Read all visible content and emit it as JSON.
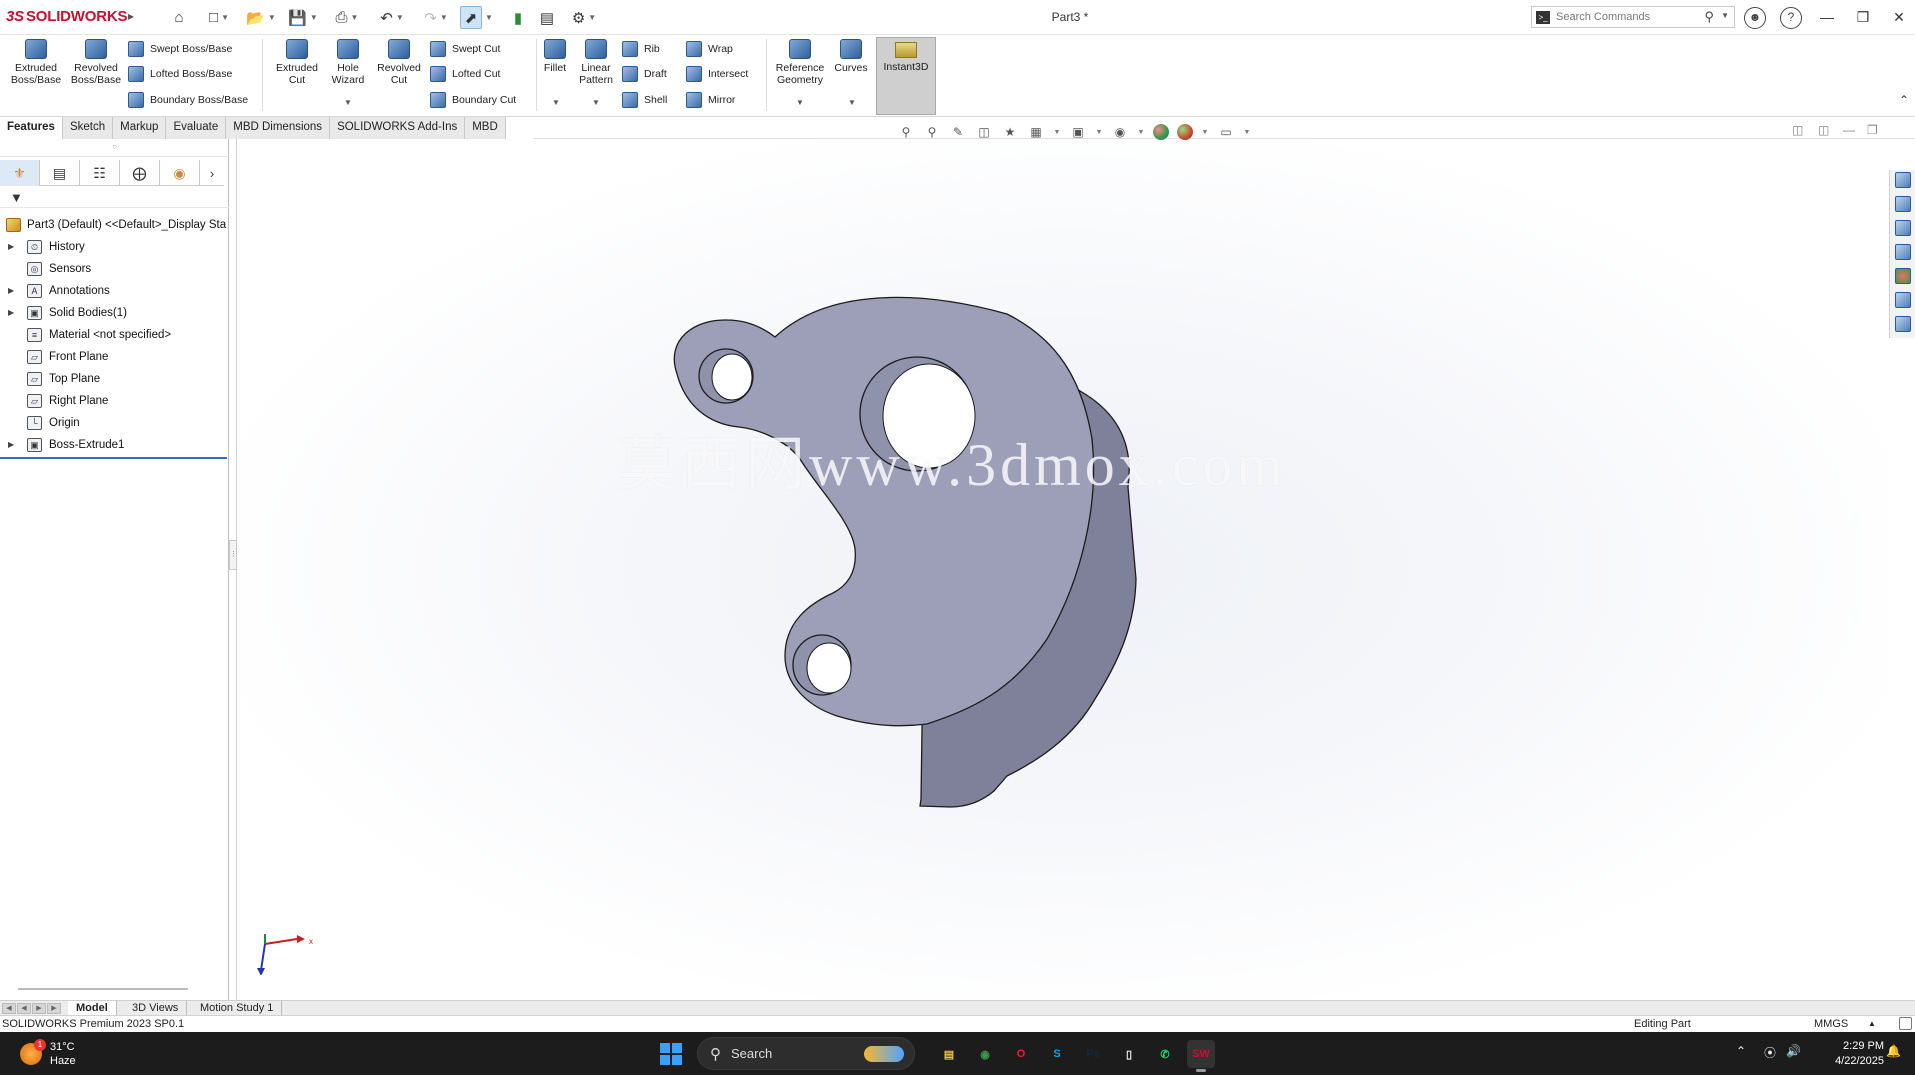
{
  "app": {
    "brand_prefix": "3S",
    "brand": "SOLIDWORKS",
    "document_title": "Part3 *"
  },
  "search": {
    "placeholder": "Search Commands"
  },
  "ribbon": {
    "extruded_boss": "Extruded Boss/Base",
    "revolved_boss": "Revolved Boss/Base",
    "swept_boss": "Swept Boss/Base",
    "lofted_boss": "Lofted Boss/Base",
    "boundary_boss": "Boundary Boss/Base",
    "extruded_cut": "Extruded Cut",
    "hole_wizard": "Hole Wizard",
    "revolved_cut": "Revolved Cut",
    "swept_cut": "Swept Cut",
    "lofted_cut": "Lofted Cut",
    "boundary_cut": "Boundary Cut",
    "fillet": "Fillet",
    "linear_pattern": "Linear Pattern",
    "rib": "Rib",
    "draft": "Draft",
    "shell": "Shell",
    "wrap": "Wrap",
    "intersect": "Intersect",
    "mirror": "Mirror",
    "reference_geometry": "Reference Geometry",
    "curves": "Curves",
    "instant3d": "Instant3D"
  },
  "command_tabs": [
    "Features",
    "Sketch",
    "Markup",
    "Evaluate",
    "MBD Dimensions",
    "SOLIDWORKS Add-Ins",
    "MBD"
  ],
  "feature_tree": {
    "root": "Part3 (Default) <<Default>_Display Sta",
    "items": [
      {
        "label": "History",
        "expandable": true,
        "icon": "history-icon",
        "glyph": "⏲"
      },
      {
        "label": "Sensors",
        "expandable": false,
        "icon": "sensor-icon",
        "glyph": "◎"
      },
      {
        "label": "Annotations",
        "expandable": true,
        "icon": "annotations-icon",
        "glyph": "A"
      },
      {
        "label": "Solid Bodies(1)",
        "expandable": true,
        "icon": "solid-bodies-icon",
        "glyph": "▣"
      },
      {
        "label": "Material <not specified>",
        "expandable": false,
        "icon": "material-icon",
        "glyph": "≡"
      },
      {
        "label": "Front Plane",
        "expandable": false,
        "icon": "plane-icon",
        "glyph": "▱"
      },
      {
        "label": "Top Plane",
        "expandable": false,
        "icon": "plane-icon",
        "glyph": "▱"
      },
      {
        "label": "Right Plane",
        "expandable": false,
        "icon": "plane-icon",
        "glyph": "▱"
      },
      {
        "label": "Origin",
        "expandable": false,
        "icon": "origin-icon",
        "glyph": "└"
      },
      {
        "label": "Boss-Extrude1",
        "expandable": true,
        "icon": "extrude-feature-icon",
        "glyph": "▣"
      }
    ]
  },
  "watermark": "莫西网www.3dmox.com",
  "triad": {
    "x_label": "x"
  },
  "bottom_tabs": [
    "Model",
    "3D Views",
    "Motion Study 1"
  ],
  "status": {
    "version": "SOLIDWORKS Premium 2023 SP0.1",
    "mode": "Editing Part",
    "units": "MMGS"
  },
  "taskbar": {
    "weather_temp": "31°C",
    "weather_desc": "Haze",
    "weather_badge": "1",
    "search_label": "Search",
    "time": "2:29 PM",
    "date": "4/22/2025",
    "apps": [
      {
        "name": "file-explorer",
        "glyph": "▤",
        "color": "#f3c13a",
        "active": false
      },
      {
        "name": "chrome",
        "glyph": "◉",
        "color": "#3c9a4a",
        "active": false
      },
      {
        "name": "opera",
        "glyph": "O",
        "color": "#e0262b",
        "active": false
      },
      {
        "name": "skype",
        "glyph": "S",
        "color": "#1aa0e8",
        "active": false
      },
      {
        "name": "photoshop",
        "glyph": "Ps",
        "color": "#0b2a4a",
        "active": false
      },
      {
        "name": "notepad",
        "glyph": "▯",
        "color": "#f2f2f2",
        "active": false
      },
      {
        "name": "whatsapp",
        "glyph": "✆",
        "color": "#25d366",
        "active": false
      },
      {
        "name": "solidworks-2023",
        "glyph": "SW",
        "color": "#c8102e",
        "active": true
      }
    ]
  },
  "colors": {
    "part_face": "#9d9fb9",
    "part_side": "#7d8098",
    "accent": "#2a73b8",
    "brand": "#c8102e"
  }
}
